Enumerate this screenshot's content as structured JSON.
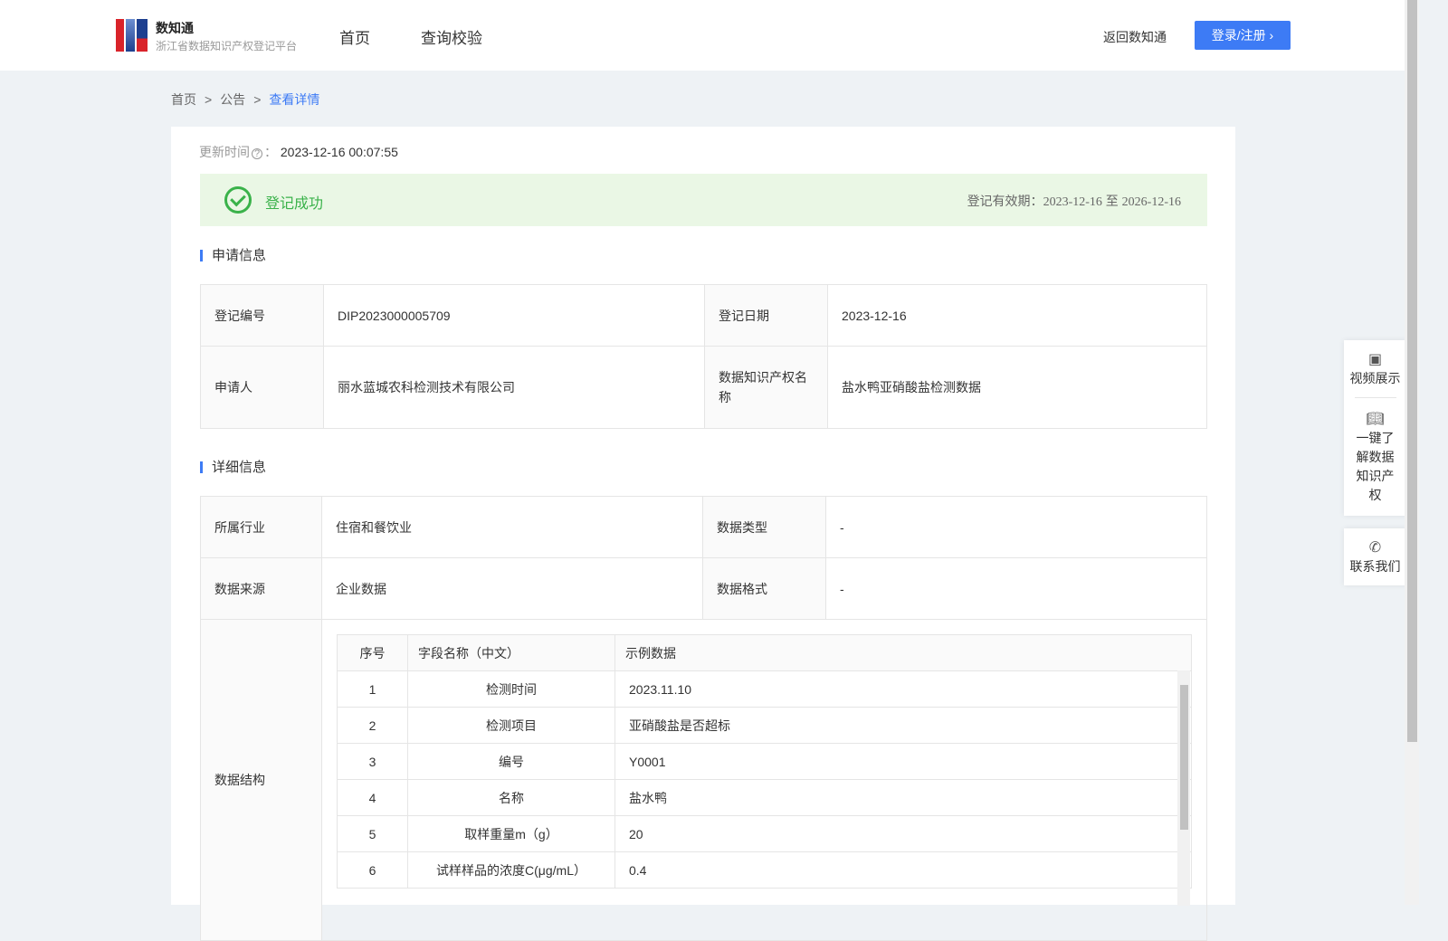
{
  "header": {
    "brand": "数知通",
    "subtitle": "浙江省数据知识产权登记平台",
    "nav": [
      "首页",
      "查询校验"
    ],
    "back": "返回数知通",
    "login": "登录/注册 ›"
  },
  "breadcrumb": [
    "首页",
    "公告",
    "查看详情"
  ],
  "update": {
    "label": "更新时间",
    "value": "2023-12-16 00:07:55"
  },
  "status": {
    "text": "登记成功",
    "valid_label": "登记有效期：",
    "from": "2023-12-16",
    "to_word": "至",
    "to": "2026-12-16"
  },
  "apply": {
    "title": "申请信息",
    "rows": [
      [
        "登记编号",
        "DIP2023000005709",
        "登记日期",
        "2023-12-16"
      ],
      [
        "申请人",
        "丽水蓝城农科检测技术有限公司",
        "数据知识产权名称",
        "盐水鸭亚硝酸盐检测数据"
      ]
    ]
  },
  "detail": {
    "title": "详细信息",
    "rows": [
      [
        "所属行业",
        "住宿和餐饮业",
        "数据类型",
        "-"
      ],
      [
        "数据来源",
        "企业数据",
        "数据格式",
        "-"
      ]
    ],
    "structure_label": "数据结构",
    "columns": [
      "序号",
      "字段名称（中文）",
      "示例数据"
    ],
    "fields": [
      [
        "1",
        "检测时间",
        "2023.11.10"
      ],
      [
        "2",
        "检测项目",
        "亚硝酸盐是否超标"
      ],
      [
        "3",
        "编号",
        "Y0001"
      ],
      [
        "4",
        "名称",
        "盐水鸭"
      ],
      [
        "5",
        "取样重量m（g）",
        "20"
      ],
      [
        "6",
        "试样样品的浓度C(μg/mL）",
        "0.4"
      ]
    ]
  },
  "float": {
    "video": "视频展示",
    "learn": "一键了解数据知识产权",
    "contact": "联系我们"
  }
}
